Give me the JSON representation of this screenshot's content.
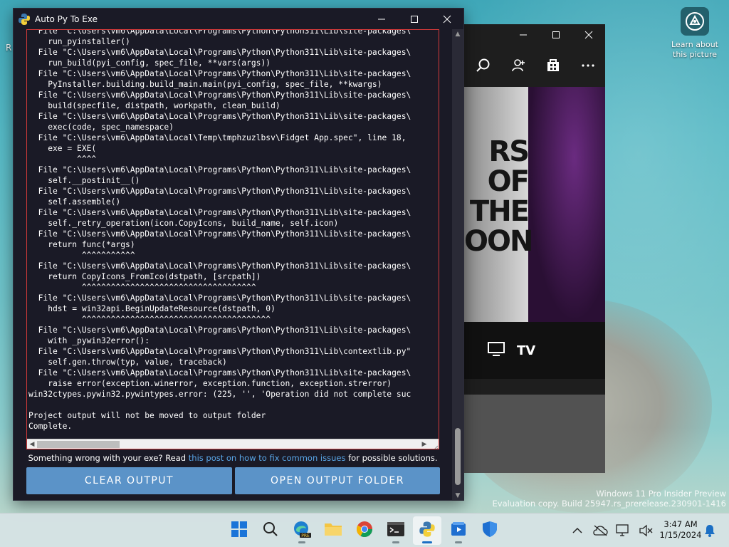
{
  "desktop": {
    "left_fragment": "R",
    "icon_label_line1": "Learn about",
    "icon_label_line2": "this picture"
  },
  "background_window": {
    "poster_text": "RS OF THE OON",
    "band_label": "TV"
  },
  "app": {
    "title": "Auto Py To Exe",
    "console_lines": [
      "  File \"C:\\Users\\vm6\\AppData\\Local\\Programs\\Python\\Python311\\Lib\\site-packages\\",
      "    run_pyinstaller()",
      "  File \"C:\\Users\\vm6\\AppData\\Local\\Programs\\Python\\Python311\\Lib\\site-packages\\",
      "    run_build(pyi_config, spec_file, **vars(args))",
      "  File \"C:\\Users\\vm6\\AppData\\Local\\Programs\\Python\\Python311\\Lib\\site-packages\\",
      "    PyInstaller.building.build_main.main(pyi_config, spec_file, **kwargs)",
      "  File \"C:\\Users\\vm6\\AppData\\Local\\Programs\\Python\\Python311\\Lib\\site-packages\\",
      "    build(specfile, distpath, workpath, clean_build)",
      "  File \"C:\\Users\\vm6\\AppData\\Local\\Programs\\Python\\Python311\\Lib\\site-packages\\",
      "    exec(code, spec_namespace)",
      "  File \"C:\\Users\\vm6\\AppData\\Local\\Temp\\tmphzuzlbsv\\Fidget App.spec\", line 18,",
      "    exe = EXE(",
      "          ^^^^",
      "  File \"C:\\Users\\vm6\\AppData\\Local\\Programs\\Python\\Python311\\Lib\\site-packages\\",
      "    self.__postinit__()",
      "  File \"C:\\Users\\vm6\\AppData\\Local\\Programs\\Python\\Python311\\Lib\\site-packages\\",
      "    self.assemble()",
      "  File \"C:\\Users\\vm6\\AppData\\Local\\Programs\\Python\\Python311\\Lib\\site-packages\\",
      "    self._retry_operation(icon.CopyIcons, build_name, self.icon)",
      "  File \"C:\\Users\\vm6\\AppData\\Local\\Programs\\Python\\Python311\\Lib\\site-packages\\",
      "    return func(*args)",
      "           ^^^^^^^^^^^",
      "  File \"C:\\Users\\vm6\\AppData\\Local\\Programs\\Python\\Python311\\Lib\\site-packages\\",
      "    return CopyIcons_FromIco(dstpath, [srcpath])",
      "           ^^^^^^^^^^^^^^^^^^^^^^^^^^^^^^^^^^^^",
      "  File \"C:\\Users\\vm6\\AppData\\Local\\Programs\\Python\\Python311\\Lib\\site-packages\\",
      "    hdst = win32api.BeginUpdateResource(dstpath, 0)",
      "           ^^^^^^^^^^^^^^^^^^^^^^^^^^^^^^^^^^^^^^^",
      "  File \"C:\\Users\\vm6\\AppData\\Local\\Programs\\Python\\Python311\\Lib\\site-packages\\",
      "    with _pywin32error():",
      "  File \"C:\\Users\\vm6\\AppData\\Local\\Programs\\Python\\Python311\\Lib\\contextlib.py\"",
      "    self.gen.throw(typ, value, traceback)",
      "  File \"C:\\Users\\vm6\\AppData\\Local\\Programs\\Python\\Python311\\Lib\\site-packages\\",
      "    raise error(exception.winerror, exception.function, exception.strerror)",
      "win32ctypes.pywin32.pywintypes.error: (225, '', 'Operation did not complete suc",
      "",
      "Project output will not be moved to output folder",
      "Complete."
    ],
    "help_prefix": "Something wrong with your exe? Read ",
    "help_link": "this post on how to fix common issues",
    "help_suffix": " for possible solutions.",
    "clear_button": "CLEAR OUTPUT",
    "open_button": "OPEN OUTPUT FOLDER"
  },
  "watermark": {
    "line1": "Windows 11 Pro Insider Preview",
    "line2": "Evaluation copy. Build 25947.rs_prerelease.230901-1416"
  },
  "taskbar": {
    "time": "3:47 AM",
    "date": "1/15/2024",
    "pre_badge": "PRE"
  },
  "colors": {
    "console_bg": "#1a1a26",
    "button": "#5b93c8",
    "link": "#5aa7e8",
    "console_border": "#d23a3a"
  }
}
